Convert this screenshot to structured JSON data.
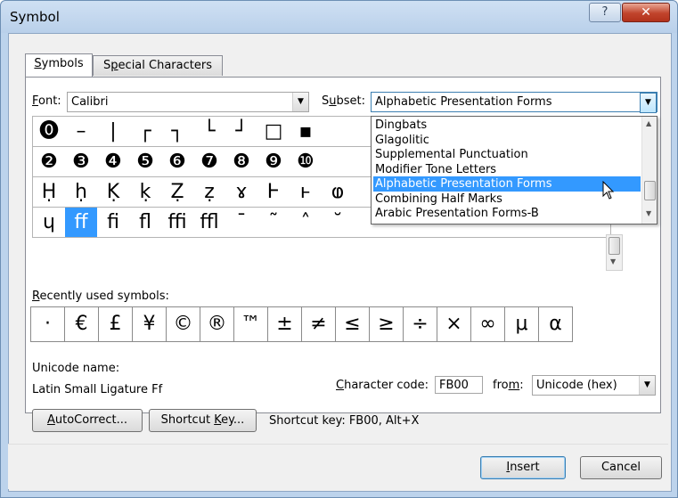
{
  "window": {
    "title": "Symbol",
    "help_glyph": "?",
    "close_glyph": "✕"
  },
  "tabs": [
    {
      "label": "Symbols",
      "mnemonic": "S",
      "rest": "ymbols",
      "active": true
    },
    {
      "label": "Special Characters",
      "mnemonic_pre": "S",
      "mnemonic": "p",
      "rest": "ecial Characters",
      "active": false
    }
  ],
  "font": {
    "label_mn": "F",
    "label_rest": "ont:",
    "value": "Calibri"
  },
  "subset": {
    "label_pre": "S",
    "label_mn": "u",
    "label_rest": "bset:",
    "value": "Alphabetic Presentation Forms"
  },
  "subset_options": [
    "Dingbats",
    "Glagolitic",
    "Supplemental Punctuation",
    "Modifier Tone Letters",
    "Alphabetic Presentation Forms",
    "Combining Half Marks",
    "Arabic Presentation Forms-B"
  ],
  "subset_highlighted_index": 4,
  "symbol_grid": [
    [
      "⓿",
      "–",
      "|",
      "┌",
      "┐",
      "└",
      "┘",
      "□",
      "▪",
      "",
      "",
      "",
      "",
      "",
      "",
      "",
      "",
      ""
    ],
    [
      "❷",
      "❸",
      "❹",
      "❺",
      "❻",
      "❼",
      "❽",
      "❾",
      "❿",
      "",
      "",
      "",
      "",
      "",
      "",
      "",
      "",
      ""
    ],
    [
      "Ḥ",
      "ḥ",
      "Ḳ",
      "ḳ",
      "Ẓ",
      "ẓ",
      "ɤ",
      "Ⱶ",
      "ⱶ",
      "ⱷ",
      "",
      "",
      "",
      "",
      "",
      "",
      "",
      ""
    ],
    [
      "ɥ",
      "ﬀ",
      "ﬁ",
      "ﬂ",
      "ﬃ",
      "ﬄ",
      "ˉ",
      "˜",
      "˄",
      "˘",
      "",
      "",
      "",
      "",
      "",
      "",
      "",
      ""
    ]
  ],
  "selected_symbol": {
    "row": 3,
    "col": 1
  },
  "recent": {
    "label": "Recently used symbols:",
    "label_mn": "R",
    "label_rest": "ecently used symbols:",
    "symbols": [
      "·",
      "€",
      "£",
      "¥",
      "©",
      "®",
      "™",
      "±",
      "≠",
      "≤",
      "≥",
      "÷",
      "×",
      "∞",
      "μ",
      "α"
    ]
  },
  "unicode": {
    "name_label": "Unicode name:",
    "name_value": "Latin Small Ligature Ff"
  },
  "char_code": {
    "label_mn": "C",
    "label_rest": "haracter code:",
    "value": "FB00"
  },
  "from": {
    "label_pre": "fro",
    "label_mn": "m",
    "label_rest": ":",
    "value": "Unicode (hex)"
  },
  "buttons": {
    "autocorrect_mn": "A",
    "autocorrect_rest": "utoCorrect...",
    "shortcut_pre": "Shortcut ",
    "shortcut_mn": "K",
    "shortcut_rest": "ey...",
    "insert_mn": "I",
    "insert_rest": "nsert",
    "cancel": "Cancel"
  },
  "shortcut_text": "Shortcut key: FB00, Alt+X",
  "colors": {
    "selection": "#3399ff",
    "title_bar": "#b9d0ea",
    "close_button": "#c1442c"
  }
}
